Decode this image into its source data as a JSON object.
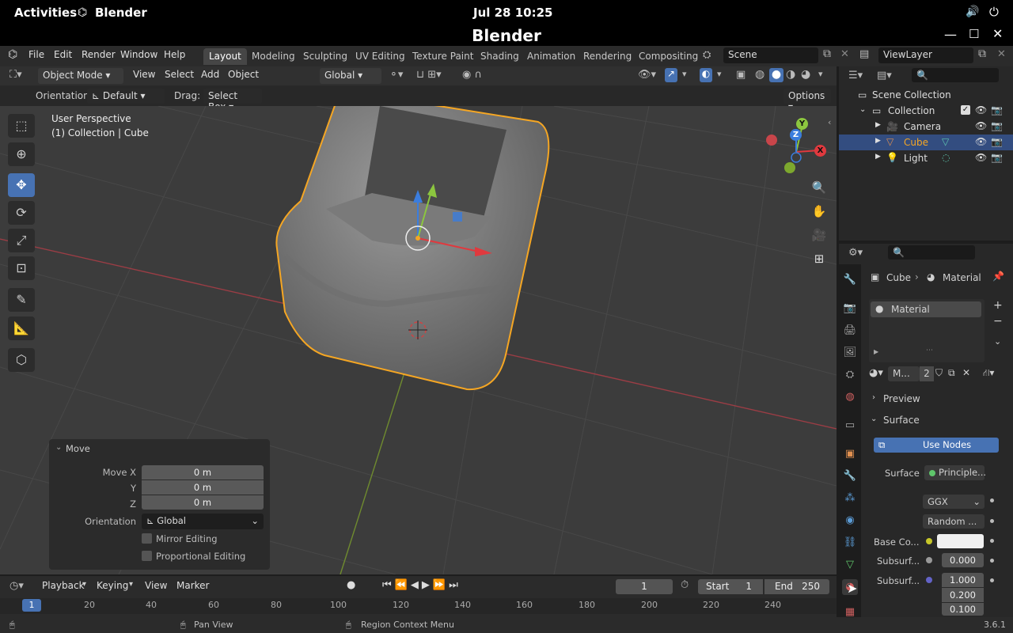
{
  "system": {
    "activities": "Activities",
    "app_name": "Blender",
    "clock": "Jul 28  10:25"
  },
  "window": {
    "title": "Blender"
  },
  "menu": [
    "File",
    "Edit",
    "Render",
    "Window",
    "Help"
  ],
  "workspaces": [
    "Layout",
    "Modeling",
    "Sculpting",
    "UV Editing",
    "Texture Paint",
    "Shading",
    "Animation",
    "Rendering",
    "Compositing"
  ],
  "scene": "Scene",
  "view_layer": "ViewLayer",
  "viewport_header": {
    "mode": "Object Mode",
    "menus": [
      "View",
      "Select",
      "Add",
      "Object"
    ],
    "transform": "Global"
  },
  "tool_settings": {
    "orientation_label": "Orientation:",
    "orientation": "Default",
    "drag_label": "Drag:",
    "drag": "Select Box",
    "options": "Options"
  },
  "viewport": {
    "perspective": "User Perspective",
    "collection_info": "(1) Collection | Cube"
  },
  "gizmo": {
    "x": "X",
    "y": "Y",
    "z": "Z"
  },
  "move_panel": {
    "title": "Move",
    "move_x_label": "Move X",
    "move_x": "0 m",
    "y_label": "Y",
    "y": "0 m",
    "z_label": "Z",
    "z": "0 m",
    "orientation_label": "Orientation",
    "orientation": "Global",
    "mirror": "Mirror Editing",
    "proportional": "Proportional Editing"
  },
  "timeline": {
    "menus": [
      "Playback",
      "Keying",
      "View",
      "Marker"
    ],
    "current_frame": "1",
    "start_label": "Start",
    "start": "1",
    "end_label": "End",
    "end": "250",
    "ruler": [
      "1",
      "20",
      "40",
      "60",
      "80",
      "100",
      "120",
      "140",
      "160",
      "180",
      "200",
      "220",
      "240"
    ]
  },
  "statusbar": {
    "pan": "Pan View",
    "context": "Region Context Menu",
    "version": "3.6.1"
  },
  "outliner": {
    "root": "Scene Collection",
    "collection": "Collection",
    "items": [
      "Camera",
      "Cube",
      "Light"
    ]
  },
  "properties": {
    "breadcrumb_obj": "Cube",
    "breadcrumb_mat": "Material",
    "slot": "Material",
    "mat_short": "M...",
    "users": "2",
    "preview": "Preview",
    "surface_section": "Surface",
    "use_nodes": "Use Nodes",
    "surface_label": "Surface",
    "surface_value": "Principle...",
    "distribution": "GGX",
    "subsurface_method": "Random ...",
    "base_color_label": "Base Co...",
    "subsurf1_label": "Subsurf...",
    "subsurf1_value": "0.000",
    "subsurf2_label": "Subsurf...",
    "radius_values": [
      "1.000",
      "0.200",
      "0.100"
    ]
  },
  "colors": {
    "accent": "#4772b3",
    "selected_outline": "#f5a623",
    "x_axis": "#e0393e",
    "y_axis": "#8cc63f",
    "z_axis": "#3b7ddd"
  }
}
